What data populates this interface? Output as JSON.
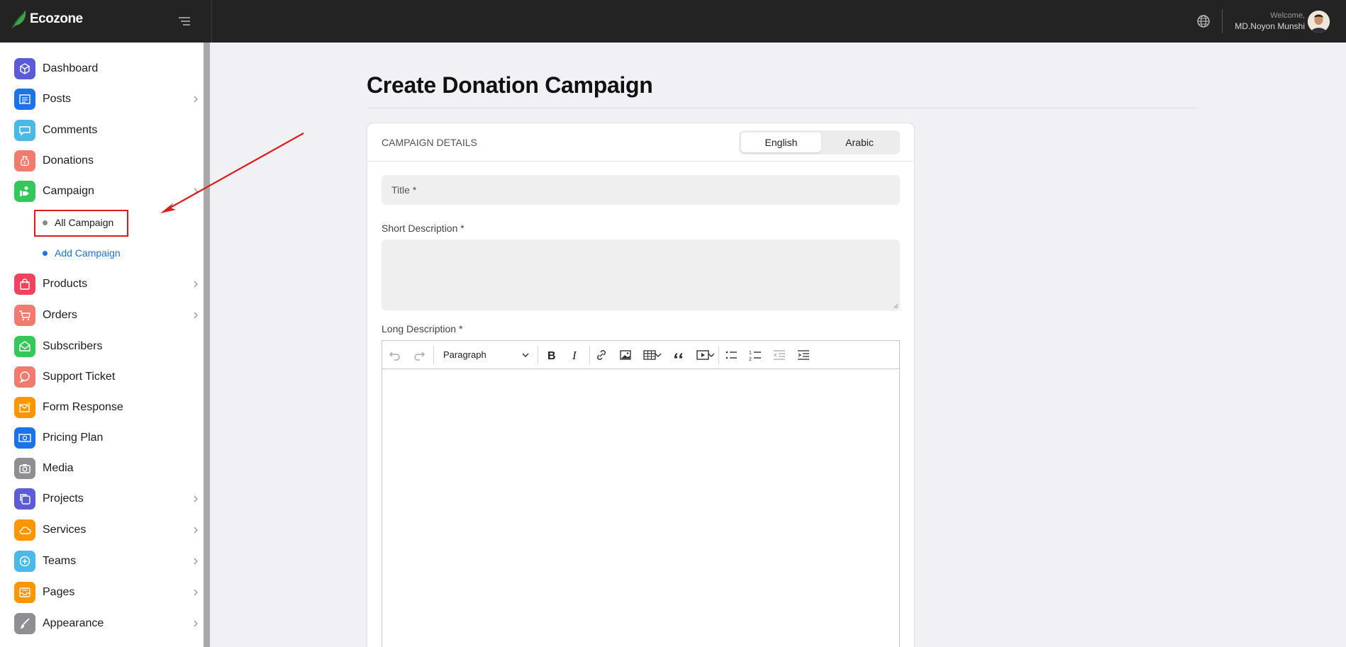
{
  "app": {
    "logo_text": "Ecozone"
  },
  "header": {
    "welcome_label": "Welcome,",
    "user_name": "MD.Noyon Munshi"
  },
  "sidebar": {
    "items": [
      {
        "label": "Dashboard",
        "icon": "box-icon",
        "color": "#5b5bd6"
      },
      {
        "label": "Posts",
        "icon": "newspaper-icon",
        "color": "#1a73e8"
      },
      {
        "label": "Comments",
        "icon": "chat-icon",
        "color": "#4ab8e8"
      },
      {
        "label": "Donations",
        "icon": "money-bag-icon",
        "color": "#f07b6e"
      },
      {
        "label": "Campaign",
        "icon": "campaign-icon",
        "color": "#34c759"
      },
      {
        "label": "Products",
        "icon": "shopping-bag-icon",
        "color": "#f0445e"
      },
      {
        "label": "Orders",
        "icon": "cart-icon",
        "color": "#f07b6e"
      },
      {
        "label": "Subscribers",
        "icon": "mail-open-icon",
        "color": "#34c759"
      },
      {
        "label": "Support Ticket",
        "icon": "support-chat-icon",
        "color": "#f07b6e"
      },
      {
        "label": "Form Response",
        "icon": "mail-badge-icon",
        "color": "#ff9500"
      },
      {
        "label": "Pricing Plan",
        "icon": "money-icon",
        "color": "#1a73e8"
      },
      {
        "label": "Media",
        "icon": "camera-icon",
        "color": "#8e8e93"
      },
      {
        "label": "Projects",
        "icon": "copy-icon",
        "color": "#5b5bd6"
      },
      {
        "label": "Services",
        "icon": "cloud-icon",
        "color": "#ff9500"
      },
      {
        "label": "Teams",
        "icon": "plus-circle-icon",
        "color": "#4ab8e8"
      },
      {
        "label": "Pages",
        "icon": "inbox-icon",
        "color": "#ff9500"
      },
      {
        "label": "Appearance",
        "icon": "brush-icon",
        "color": "#8e8e93"
      }
    ],
    "campaign_sub": [
      {
        "label": "All Campaign",
        "dot_color": "#8a8a8a",
        "text_color": "#1c1c1c"
      },
      {
        "label": "Add Campaign",
        "dot_color": "#1a73e8",
        "text_color": "#1a73e8"
      }
    ]
  },
  "main": {
    "page_title": "Create Donation Campaign",
    "card_title": "CAMPAIGN DETAILS",
    "languages": {
      "active": "English",
      "other": "Arabic"
    },
    "title_placeholder": "Title *",
    "short_desc_label": "Short Description *",
    "long_desc_label": "Long Description *",
    "editor": {
      "block_format": "Paragraph"
    }
  },
  "annotation": {
    "color": "#e01b1b"
  }
}
